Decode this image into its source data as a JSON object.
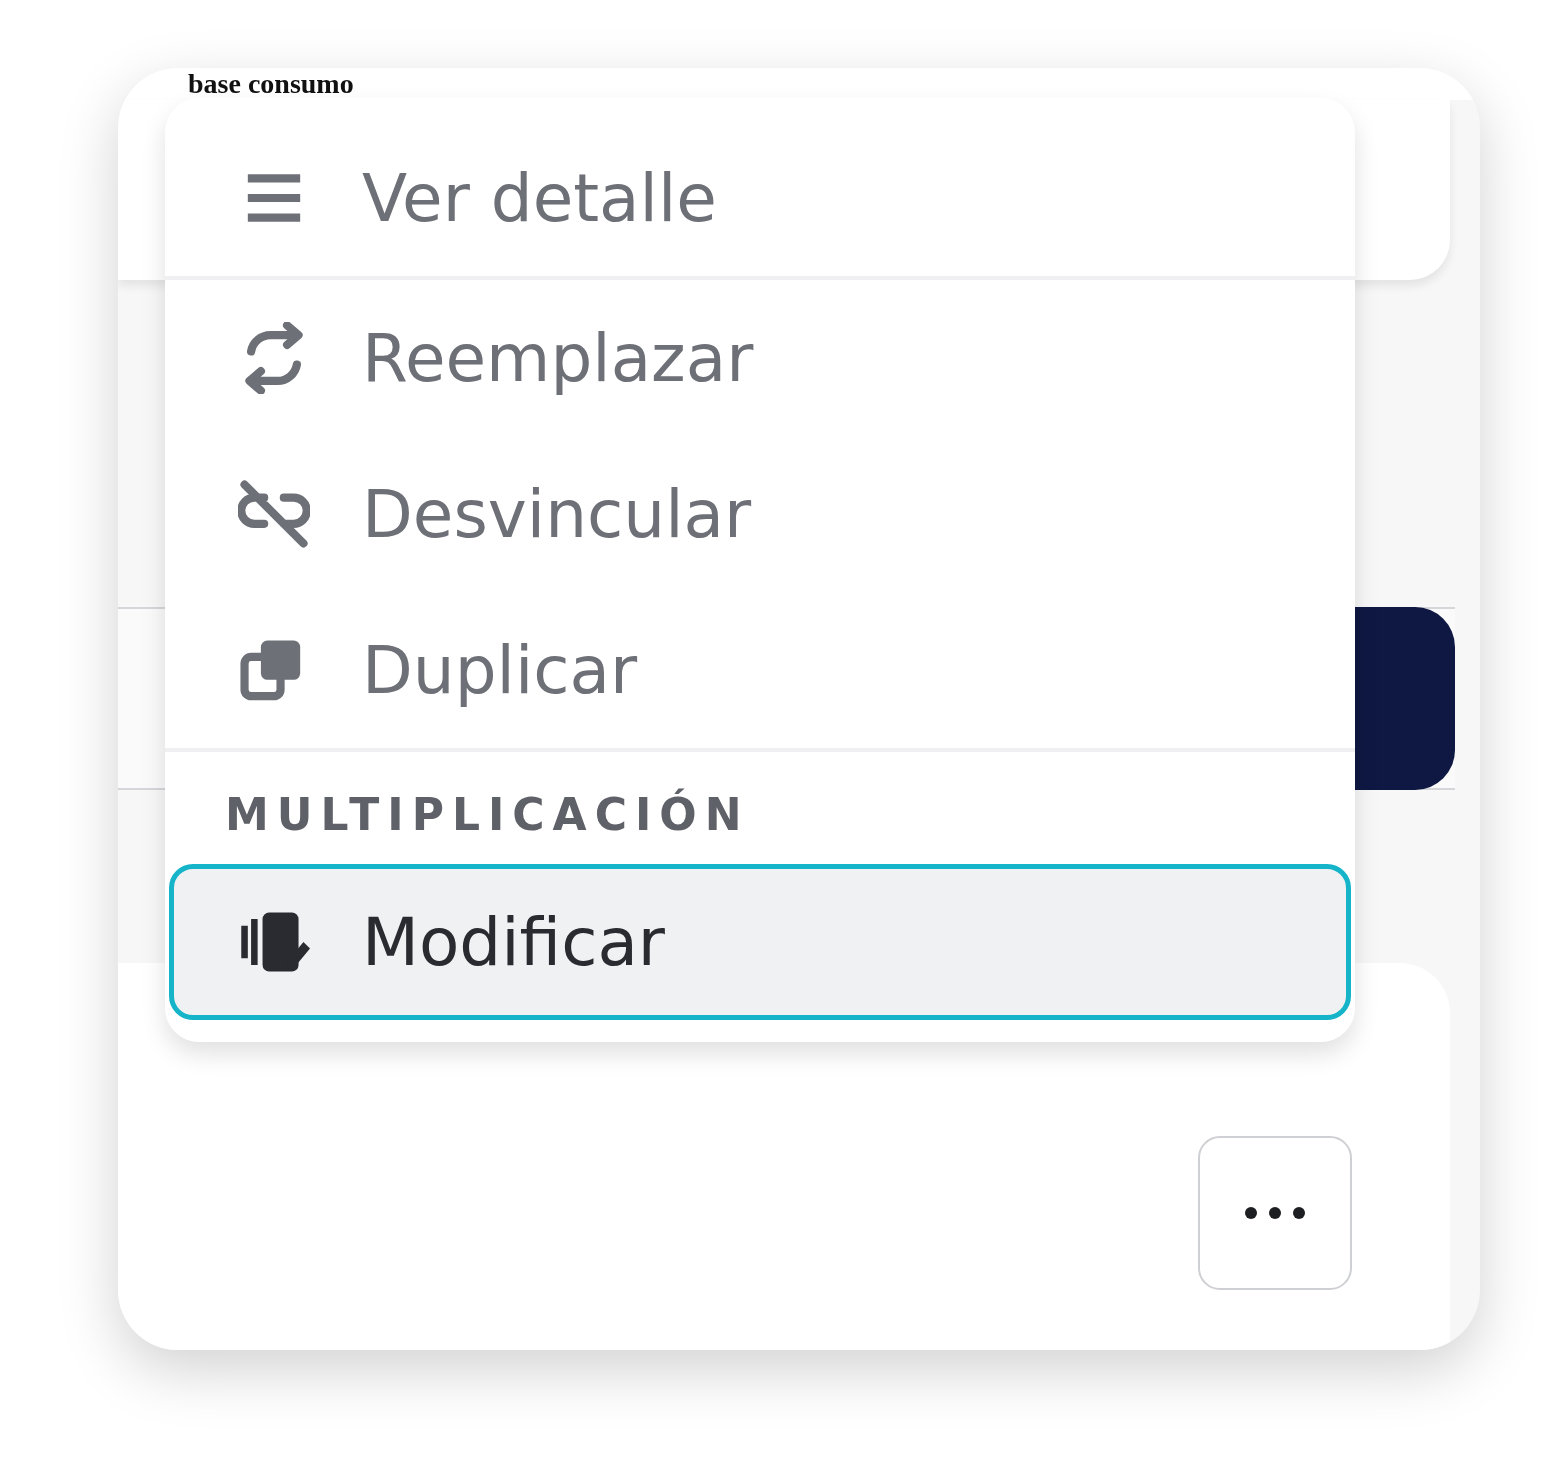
{
  "heading": "base consumo",
  "menu": [
    {
      "kind": "item",
      "label": "Ver detalle",
      "selected": false
    },
    {
      "kind": "divider"
    },
    {
      "kind": "item",
      "label": "Reemplazar",
      "selected": false
    },
    {
      "kind": "item",
      "label": "Desvincular",
      "selected": false
    },
    {
      "kind": "item",
      "label": "Duplicar",
      "selected": false
    },
    {
      "kind": "divider"
    },
    {
      "kind": "header",
      "label": "MULTIPLICACIÓN"
    },
    {
      "kind": "item",
      "label": "Modificar",
      "selected": true
    }
  ],
  "more_button": {
    "kind": "dots"
  }
}
